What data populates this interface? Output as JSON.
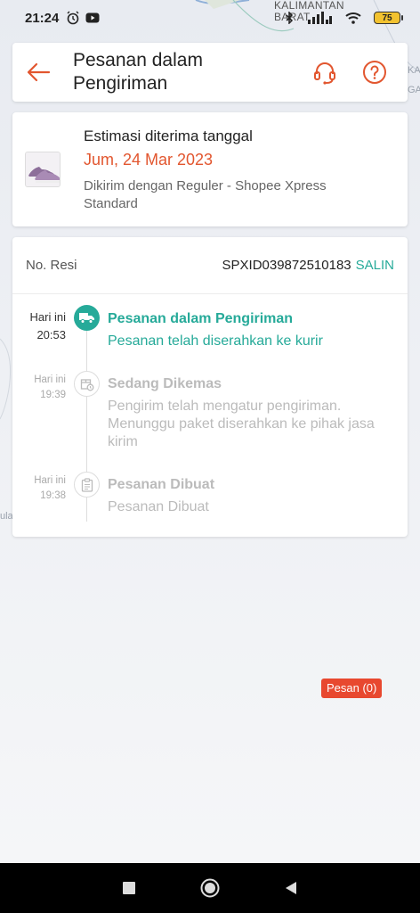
{
  "status_bar": {
    "time": "21:24",
    "battery": "75",
    "map_label_line1": "KALIMANTAN",
    "map_label_line2": "BARAT"
  },
  "header": {
    "title": "Pesanan dalam Pengiriman",
    "back_icon": "arrow-left-icon",
    "support_icon": "headset-icon",
    "help_icon": "question-icon"
  },
  "estimate": {
    "label": "Estimasi diterima tanggal",
    "date": "Jum, 24 Mar 2023",
    "courier": "Dikirim dengan Reguler - Shopee Xpress Standard"
  },
  "tracking": {
    "resi_label": "No. Resi",
    "resi_value": "SPXID039872510183",
    "copy_label": "SALIN",
    "events": [
      {
        "day": "Hari ini",
        "time": "20:53",
        "title": "Pesanan dalam Pengiriman",
        "desc": "Pesanan telah diserahkan ke kurir",
        "icon": "truck-icon"
      },
      {
        "day": "Hari ini",
        "time": "19:39",
        "title": "Sedang Dikemas",
        "desc": "Pengirim telah mengatur pengiriman. Menunggu paket diserahkan ke pihak jasa kirim",
        "icon": "package-icon"
      },
      {
        "day": "Hari ini",
        "time": "19:38",
        "title": "Pesanan Dibuat",
        "desc": "Pesanan Dibuat",
        "icon": "clipboard-icon"
      }
    ]
  },
  "chat": {
    "label": "Pesan (0)"
  },
  "colors": {
    "accent": "#26aa99",
    "brand": "#e2562f",
    "badge": "#e8482f"
  }
}
